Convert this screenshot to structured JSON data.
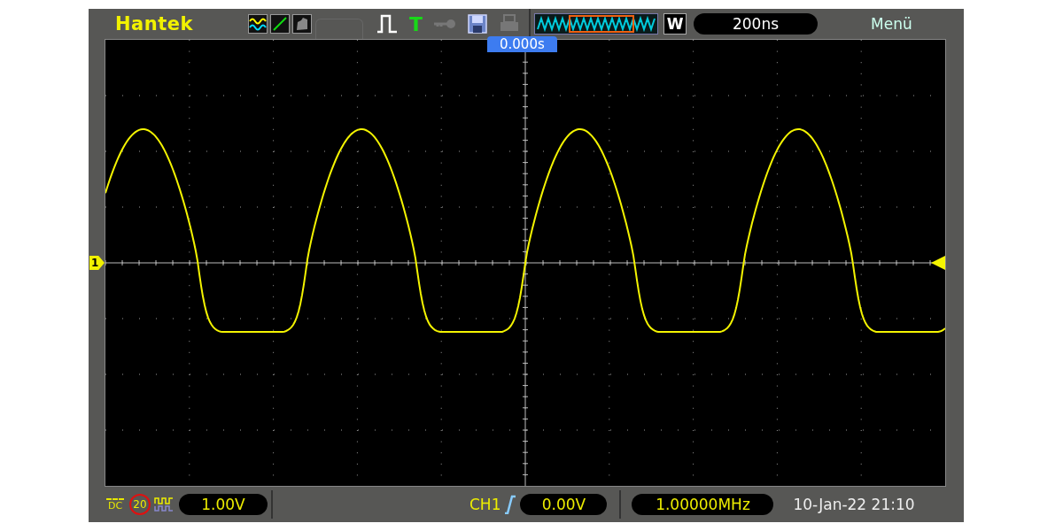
{
  "brand": "Hantek",
  "trigger_type": "T",
  "window_mode": "W",
  "timebase": "200ns",
  "menu": "Menü",
  "trigger_position": "0.000s",
  "channel_marker": "1",
  "footer": {
    "coupling": "DC",
    "bandwidth_limit": "20",
    "volts_per_div": "1.00V",
    "trigger_source": "CH1",
    "trigger_level": "0.00V",
    "frequency": "1.00000MHz",
    "datetime": "10-Jan-22 21:10"
  }
}
